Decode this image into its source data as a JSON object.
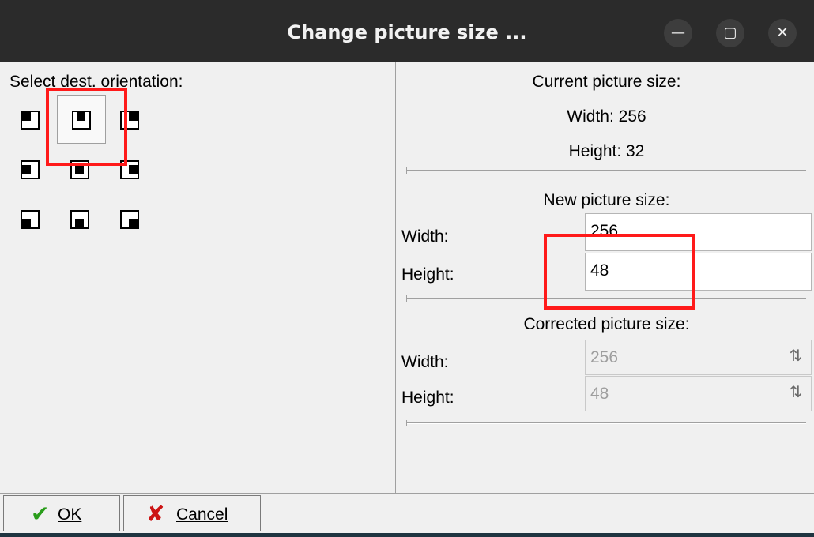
{
  "window": {
    "title": "Change picture size ...",
    "minimize_glyph": "—",
    "maximize_glyph": "▢",
    "close_glyph": "✕"
  },
  "orientation": {
    "label": "Select dest. orientation:",
    "options": [
      "top-left",
      "top-center",
      "top-right",
      "middle-left",
      "center",
      "middle-right",
      "bottom-left",
      "bottom-center",
      "bottom-right"
    ],
    "selected": "top-center"
  },
  "current": {
    "heading": "Current picture size:",
    "width_text": "Width: 256",
    "height_text": "Height: 32"
  },
  "new_size": {
    "heading": "New picture size:",
    "width_label": "Width:",
    "width_value": "256",
    "height_label": "Height:",
    "height_value": "48"
  },
  "corrected": {
    "heading": "Corrected picture size:",
    "width_label": "Width:",
    "width_value": "256",
    "height_label": "Height:",
    "height_value": "48"
  },
  "buttons": {
    "ok_label": "OK",
    "cancel_label": "Cancel"
  },
  "icons": {
    "ok": "check-icon",
    "cancel": "cross-icon",
    "spin": "spin-arrows-icon"
  },
  "colors": {
    "titlebar": "#2b2b2b",
    "highlight": "#ff1a1a",
    "ok_check": "#2a9d1b",
    "cancel_cross": "#cc1414"
  }
}
